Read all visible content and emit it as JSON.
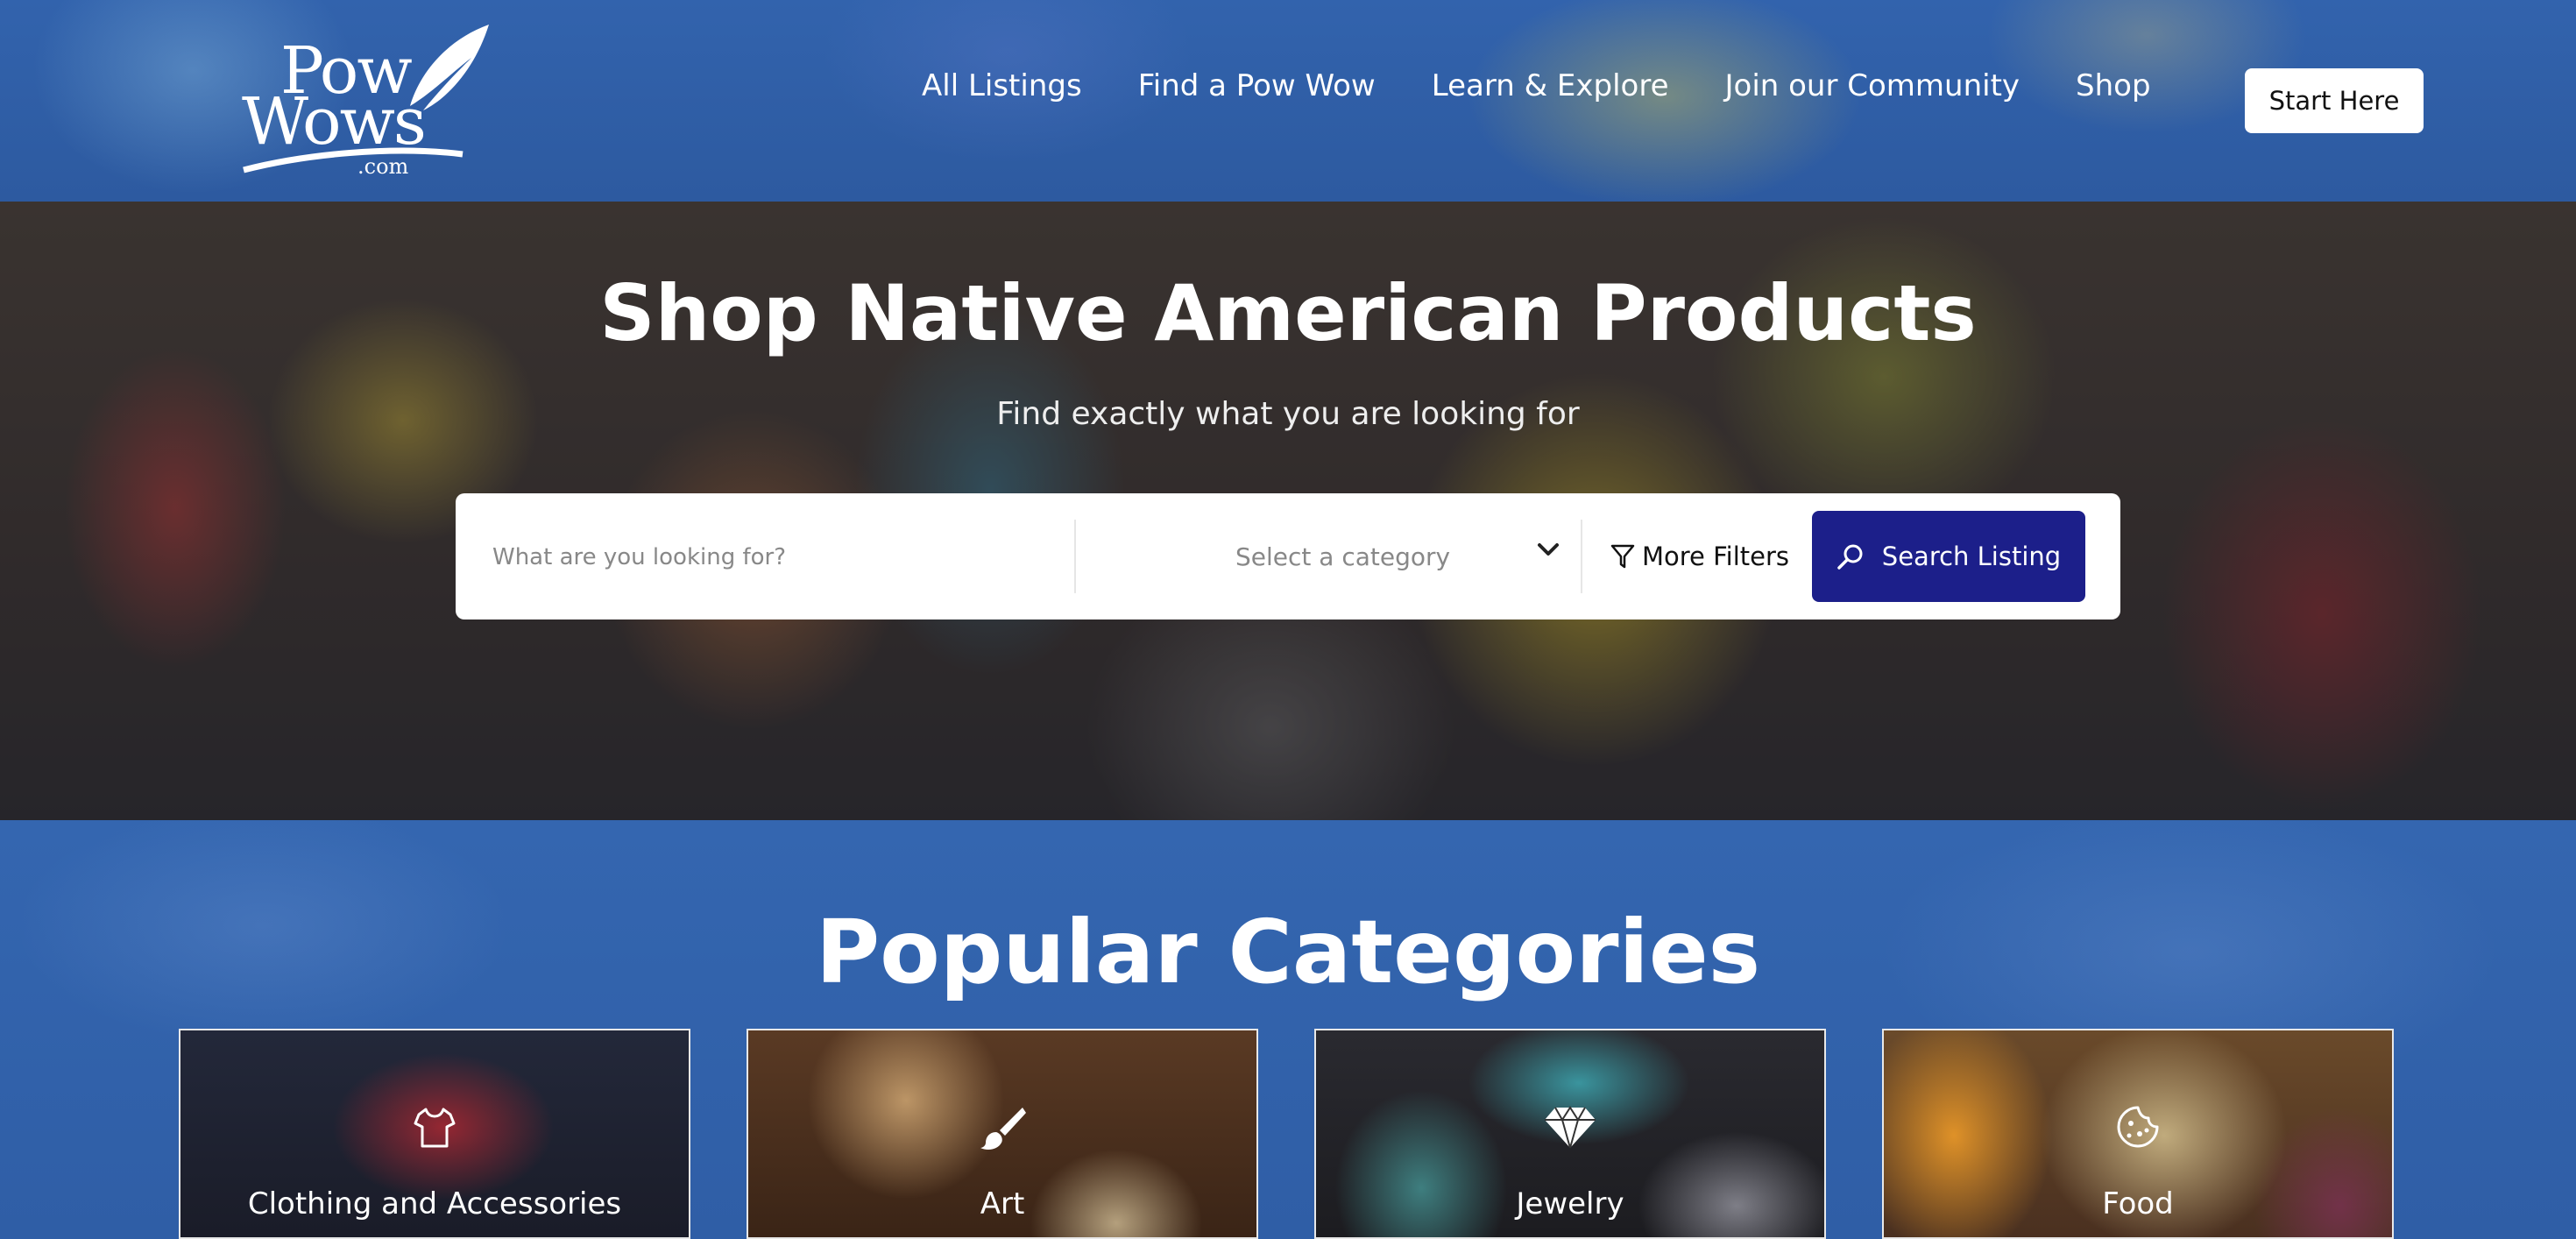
{
  "header": {
    "logo": {
      "line1": "Pow",
      "line2": "Wows",
      "line3": ".com"
    },
    "nav": [
      {
        "label": "All Listings"
      },
      {
        "label": "Find a Pow Wow"
      },
      {
        "label": "Learn & Explore"
      },
      {
        "label": "Join our Community"
      },
      {
        "label": "Shop"
      }
    ],
    "cta_label": "Start Here"
  },
  "hero": {
    "title": "Shop Native American Products",
    "subtitle": "Find exactly what you are looking for",
    "search": {
      "placeholder": "What are you looking for?",
      "category_label": "Select a category",
      "filters_label": "More Filters",
      "button_label": "Search Listing"
    }
  },
  "categories": {
    "title": "Popular Categories",
    "items": [
      {
        "label": "Clothing and Accessories",
        "icon": "shirt-icon"
      },
      {
        "label": "Art",
        "icon": "paintbrush-icon"
      },
      {
        "label": "Jewelry",
        "icon": "diamond-icon"
      },
      {
        "label": "Food",
        "icon": "cookie-icon"
      }
    ]
  },
  "colors": {
    "primary_blue": "#2f5ea6",
    "search_button": "#1c1f8a",
    "white": "#ffffff"
  }
}
